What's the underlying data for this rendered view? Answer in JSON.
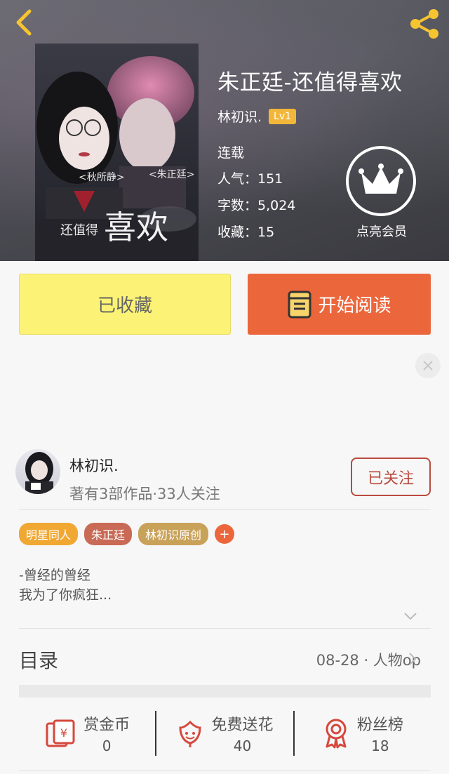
{
  "header": {
    "title": "朱正廷-还值得喜欢",
    "author": "林初识.",
    "level": "Lv1",
    "status": "连载",
    "popularity": "人气：151",
    "word_count": "字数：5,024",
    "favorites": "收藏：15",
    "vip_label": "点亮会员"
  },
  "cover": {
    "name_left": "<秋所静>",
    "name_right": "<朱正廷>",
    "title_small": "还值得",
    "title_big": "喜欢"
  },
  "actions": {
    "favorited_label": "已收藏",
    "read_label": "开始阅读"
  },
  "author_card": {
    "name": "林初识.",
    "summary": "著有3部作品·33人关注",
    "follow_label": "已关注"
  },
  "tags": [
    {
      "label": "明星同人",
      "color": "#f1a833"
    },
    {
      "label": "朱正廷",
      "color": "#c96a56"
    },
    {
      "label": "林初识原创",
      "color": "#c9a25a"
    }
  ],
  "tag_add": "+",
  "description": {
    "line1": "-曾经的曾经",
    "line2": "我为了你疯狂..."
  },
  "toc": {
    "label": "目录",
    "latest": "08-28 · 人物op"
  },
  "stats": [
    {
      "label": "赏金币",
      "value": "0"
    },
    {
      "label": "免费送花",
      "value": "40"
    },
    {
      "label": "粉丝榜",
      "value": "18"
    }
  ],
  "colors": {
    "accent": "#ec663c",
    "favorite_bg": "#fcf376",
    "follow": "#b94a3f",
    "level_badge": "#f2b73a",
    "share_icon": "#f6c431"
  }
}
